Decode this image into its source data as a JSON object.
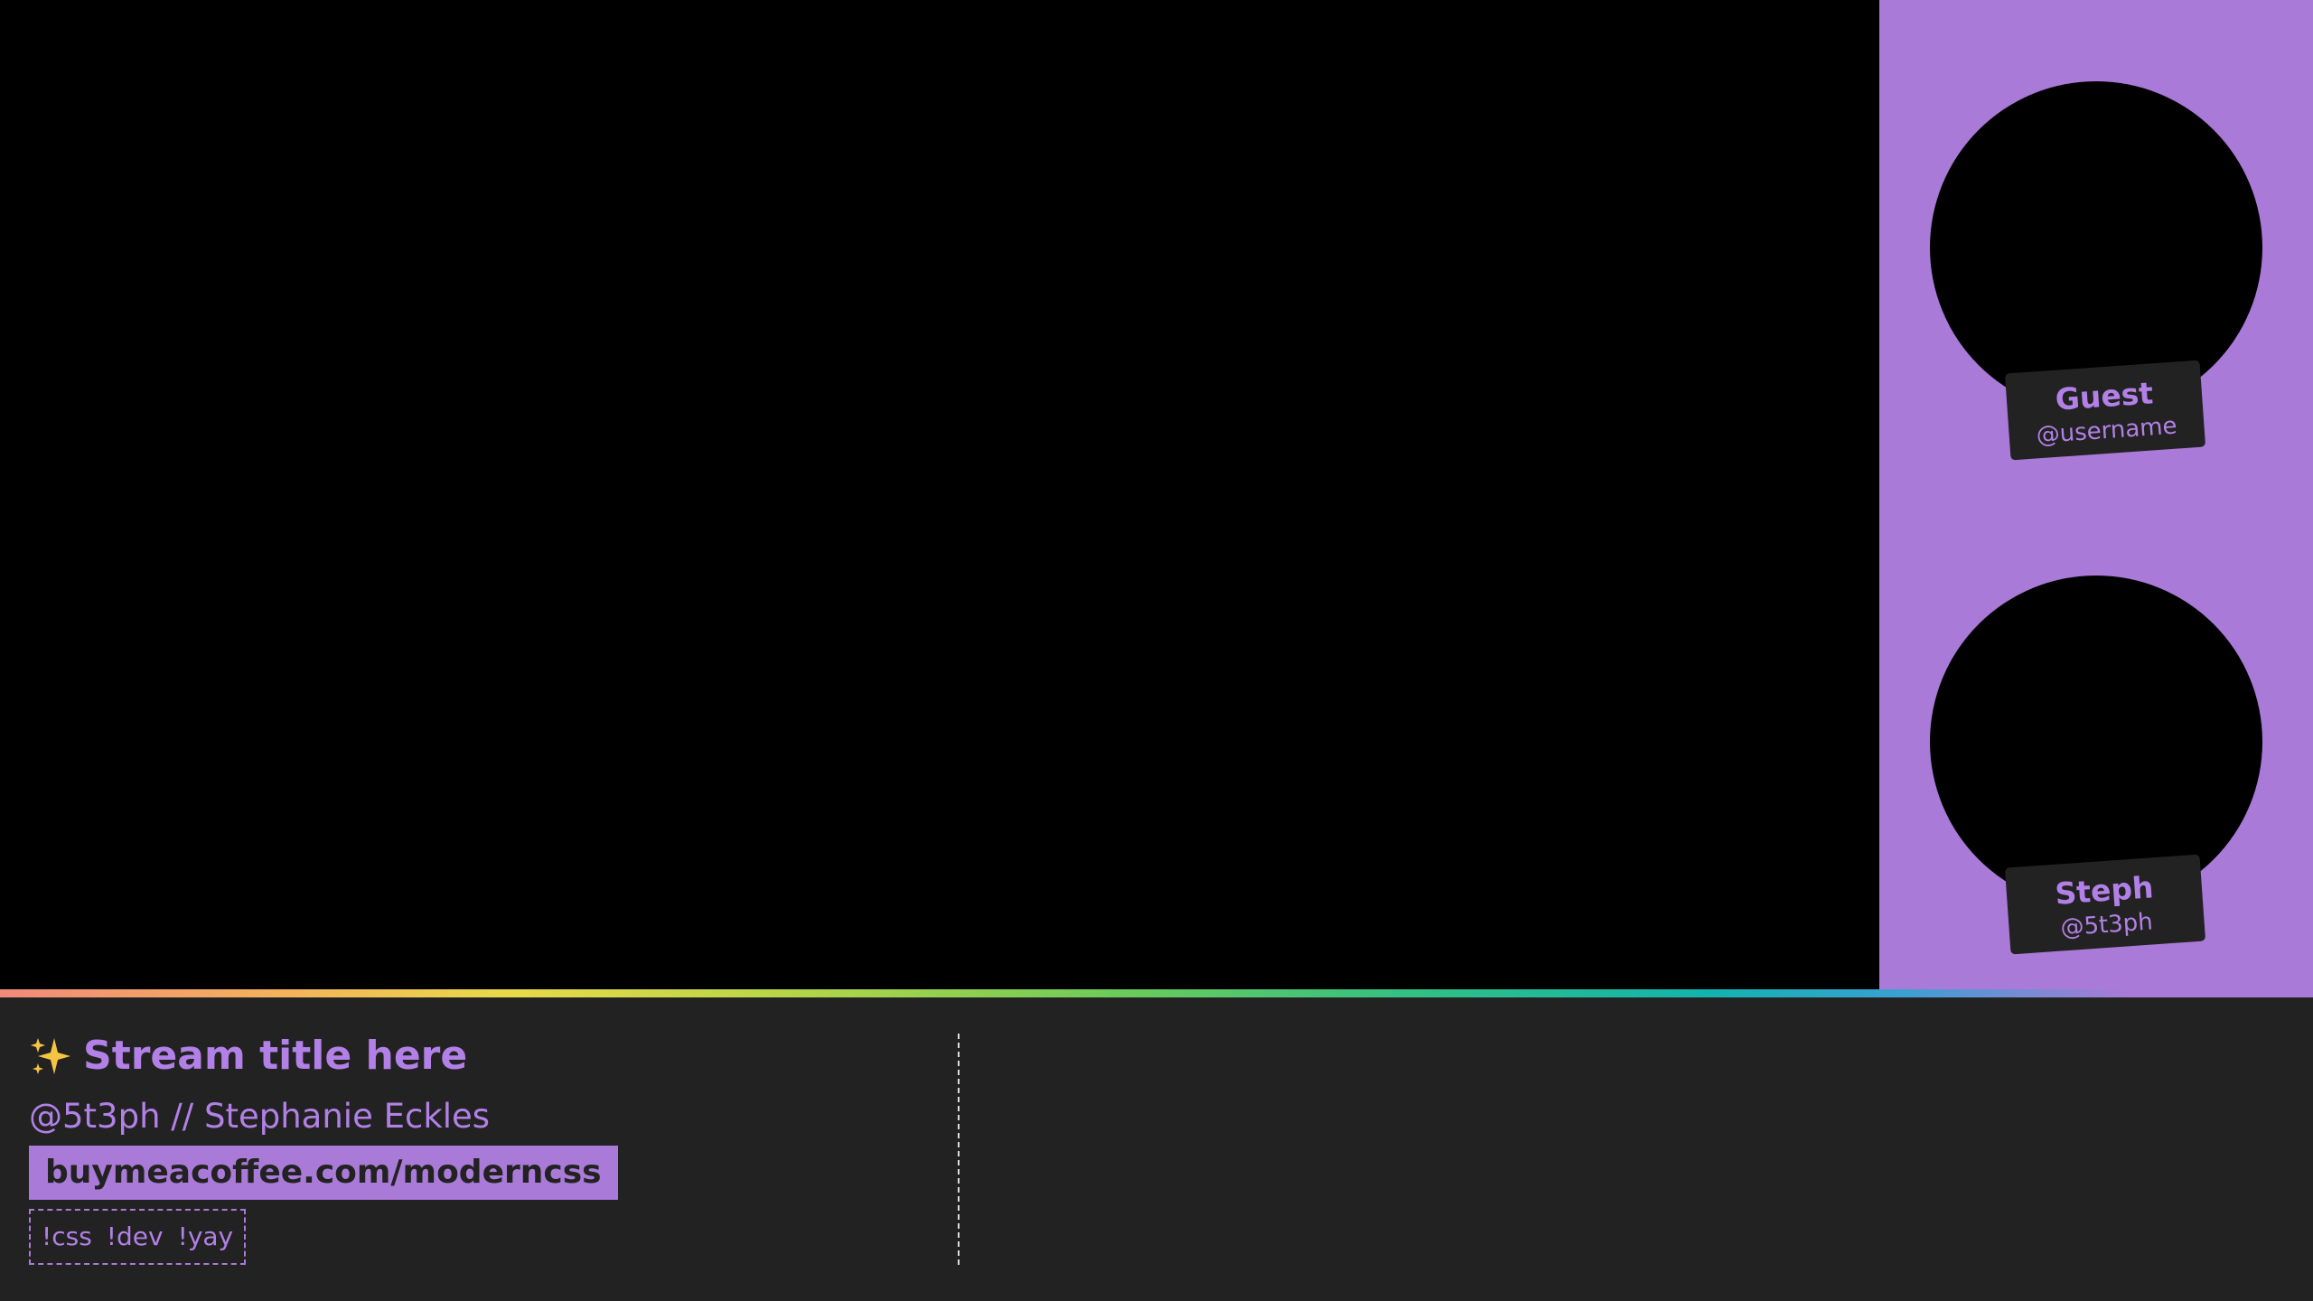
{
  "colors": {
    "accent": "#a97ad7",
    "text_accent": "#b280e6",
    "bar_background": "#222222",
    "video_background": "#000000"
  },
  "cameras": [
    {
      "name": "Guest",
      "handle": "@username"
    },
    {
      "name": "Steph",
      "handle": "@5t3ph"
    }
  ],
  "info": {
    "icon": "sparkles-icon",
    "title": "Stream title here",
    "byline": "@5t3ph // Stephanie Eckles",
    "link": "buymeacoffee.com/moderncss",
    "commands": [
      "!css",
      "!dev",
      "!yay"
    ]
  }
}
